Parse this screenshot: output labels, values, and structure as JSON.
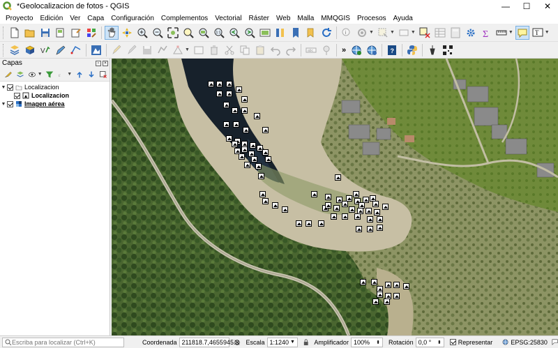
{
  "window": {
    "title": "*Geolocalizacion de fotos - QGIS",
    "minimize": "—",
    "maximize": "☐",
    "close": "✕"
  },
  "menu": [
    "Proyecto",
    "Edición",
    "Ver",
    "Capa",
    "Configuración",
    "Complementos",
    "Vectorial",
    "Ráster",
    "Web",
    "Malla",
    "MMQGIS",
    "Procesos",
    "Ayuda"
  ],
  "layers_panel": {
    "title": "Capas",
    "layers": [
      {
        "name": "Localizacion",
        "type": "group",
        "checked": true,
        "expanded": true
      },
      {
        "name": "Localizacion",
        "type": "point-layer",
        "checked": true
      },
      {
        "name": "Imagen aérea",
        "type": "raster-layer",
        "checked": true
      }
    ]
  },
  "statusbar": {
    "locator_placeholder": "Escriba para localizar (Ctrl+K)",
    "coord_label": "Coordenada",
    "coord_value": "211818.7,4655945.8",
    "scale_label": "Escala",
    "scale_value": "1:1240",
    "magnifier_label": "Amplificador",
    "magnifier_value": "100%",
    "rotation_label": "Rotación",
    "rotation_value": "0,0 °",
    "render_label": "Representar",
    "crs": "EPSG:25830"
  },
  "colors": {
    "map_dark_river": "#1a2530",
    "map_forest": "#3d5a2a",
    "map_sand": "#c9c0a8",
    "map_grass": "#7a8f4a"
  }
}
